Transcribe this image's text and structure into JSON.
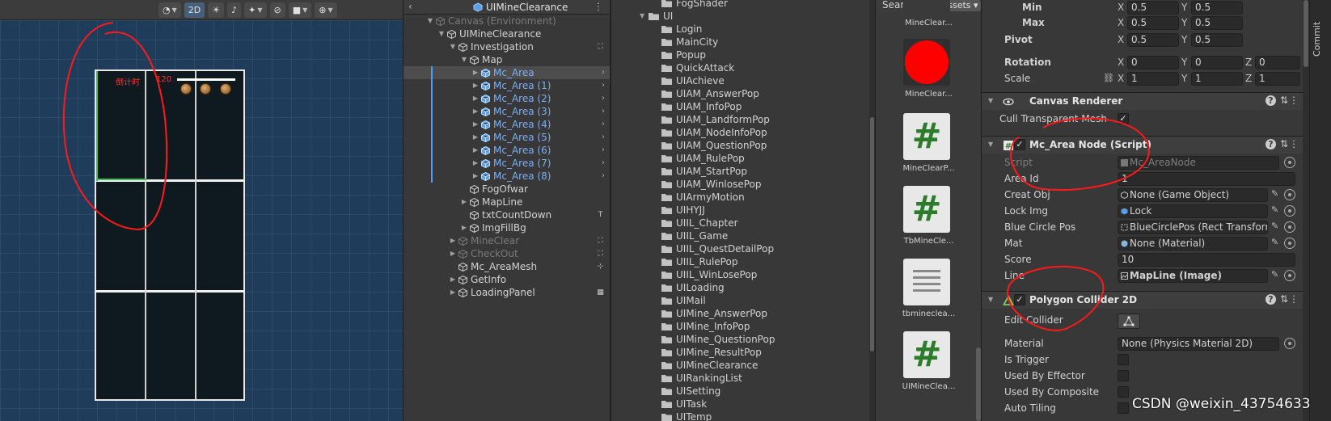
{
  "scene": {
    "toolbar": {
      "shading_icon": "sphere-icon",
      "mode_2d": "2D",
      "light_icon": "light-icon",
      "audio_icon": "audio-icon",
      "effects_icon": "effects-icon",
      "visibility_icon": "visibility-off-icon",
      "camera_icon": "camera-icon",
      "gizmo_icon": "gizmo-icon"
    },
    "canvas": {
      "countdown_label": "倒计时",
      "countdown_value": "120"
    },
    "annotation_color": "#ff1a1a"
  },
  "hierarchy": {
    "title": "UIMineClearance",
    "rows": [
      {
        "label": "Canvas (Environment)",
        "depth": 3,
        "arrow": "▼",
        "dim": true
      },
      {
        "label": "UIMineClearance",
        "depth": 4,
        "arrow": "▼"
      },
      {
        "label": "Investigation",
        "depth": 5,
        "arrow": "▼",
        "right_icon": "⛶"
      },
      {
        "label": "Map",
        "depth": 6,
        "arrow": "▼"
      },
      {
        "label": "Mc_Area",
        "depth": 7,
        "arrow": "▶",
        "blue": true,
        "selected": true,
        "chevron": "›",
        "bar": true
      },
      {
        "label": "Mc_Area (1)",
        "depth": 7,
        "arrow": "▶",
        "blue": true,
        "chevron": "›",
        "bar": true
      },
      {
        "label": "Mc_Area (2)",
        "depth": 7,
        "arrow": "▶",
        "blue": true,
        "chevron": "›",
        "bar": true
      },
      {
        "label": "Mc_Area (3)",
        "depth": 7,
        "arrow": "▶",
        "blue": true,
        "chevron": "›",
        "bar": true
      },
      {
        "label": "Mc_Area (4)",
        "depth": 7,
        "arrow": "▶",
        "blue": true,
        "chevron": "›",
        "bar": true
      },
      {
        "label": "Mc_Area (5)",
        "depth": 7,
        "arrow": "▶",
        "blue": true,
        "chevron": "›",
        "bar": true
      },
      {
        "label": "Mc_Area (6)",
        "depth": 7,
        "arrow": "▶",
        "blue": true,
        "chevron": "›",
        "bar": true
      },
      {
        "label": "Mc_Area (7)",
        "depth": 7,
        "arrow": "▶",
        "blue": true,
        "chevron": "›",
        "bar": true
      },
      {
        "label": "Mc_Area (8)",
        "depth": 7,
        "arrow": "▶",
        "blue": true,
        "chevron": "›",
        "bar": true
      },
      {
        "label": "FogOfwar",
        "depth": 6,
        "arrow": ""
      },
      {
        "label": "MapLine",
        "depth": 6,
        "arrow": "▶"
      },
      {
        "label": "txtCountDown",
        "depth": 6,
        "arrow": "",
        "right_icon": "T"
      },
      {
        "label": "ImgFillBg",
        "depth": 6,
        "arrow": "▶"
      },
      {
        "label": "MineClear",
        "depth": 5,
        "arrow": "▶",
        "dim": true,
        "right_icon": "⛶"
      },
      {
        "label": "CheckOut",
        "depth": 5,
        "arrow": "▶",
        "dim": true,
        "right_icon": "⛶"
      },
      {
        "label": "Mc_AreaMesh",
        "depth": 5,
        "arrow": "",
        "right_icon": "⊹"
      },
      {
        "label": "GetInfo",
        "depth": 5,
        "arrow": "▶"
      },
      {
        "label": "LoadingPanel",
        "depth": 5,
        "arrow": "▶",
        "right_icon": "▦"
      }
    ]
  },
  "project": {
    "rows": [
      {
        "label": "FogShader",
        "indent": 2
      },
      {
        "label": "UI",
        "indent": 1,
        "arrow": "▼"
      },
      {
        "label": "Login",
        "indent": 2
      },
      {
        "label": "MainCity",
        "indent": 2
      },
      {
        "label": "Popup",
        "indent": 2
      },
      {
        "label": "QuickAttack",
        "indent": 2
      },
      {
        "label": "UIAchieve",
        "indent": 2
      },
      {
        "label": "UIAM_AnswerPop",
        "indent": 2
      },
      {
        "label": "UIAM_InfoPop",
        "indent": 2
      },
      {
        "label": "UIAM_LandformPop",
        "indent": 2
      },
      {
        "label": "UIAM_NodeInfoPop",
        "indent": 2
      },
      {
        "label": "UIAM_QuestionPop",
        "indent": 2
      },
      {
        "label": "UIAM_RulePop",
        "indent": 2
      },
      {
        "label": "UIAM_StartPop",
        "indent": 2
      },
      {
        "label": "UIAM_WinlosePop",
        "indent": 2
      },
      {
        "label": "UIArmyMotion",
        "indent": 2
      },
      {
        "label": "UIHYJJ",
        "indent": 2
      },
      {
        "label": "UIIL_Chapter",
        "indent": 2
      },
      {
        "label": "UIIL_Game",
        "indent": 2
      },
      {
        "label": "UIIL_QuestDetailPop",
        "indent": 2
      },
      {
        "label": "UIIL_RulePop",
        "indent": 2
      },
      {
        "label": "UIIL_WinLosePop",
        "indent": 2
      },
      {
        "label": "UILoading",
        "indent": 2
      },
      {
        "label": "UIMail",
        "indent": 2
      },
      {
        "label": "UIMine_AnswerPop",
        "indent": 2
      },
      {
        "label": "UIMine_InfoPop",
        "indent": 2
      },
      {
        "label": "UIMine_QuestionPop",
        "indent": 2
      },
      {
        "label": "UIMine_ResultPop",
        "indent": 2
      },
      {
        "label": "UIMineClearance",
        "indent": 2
      },
      {
        "label": "UIRankingList",
        "indent": 2
      },
      {
        "label": "UISetting",
        "indent": 2
      },
      {
        "label": "UITask",
        "indent": 2
      },
      {
        "label": "UITemp",
        "indent": 2
      }
    ]
  },
  "assets": {
    "search_label": "Search:",
    "search_scope": "In Assets",
    "items": [
      {
        "name": "MineClear...",
        "kind": "partial"
      },
      {
        "name": "MineClear...",
        "kind": "red-circle"
      },
      {
        "name": "MineClearP...",
        "kind": "script"
      },
      {
        "name": "TbMineCle...",
        "kind": "script"
      },
      {
        "name": "tbminecleа...",
        "kind": "text"
      },
      {
        "name": "UIMineClea...",
        "kind": "script"
      }
    ]
  },
  "inspector": {
    "min": {
      "label": "Min",
      "x": "0.5",
      "y": "0.5"
    },
    "max": {
      "label": "Max",
      "x": "0.5",
      "y": "0.5"
    },
    "pivot": {
      "label": "Pivot",
      "x": "0.5",
      "y": "0.5"
    },
    "rotation": {
      "label": "Rotation",
      "x": "0",
      "y": "0",
      "z": "0"
    },
    "scale": {
      "label": "Scale",
      "x": "1",
      "y": "1",
      "z": "1"
    },
    "axis": {
      "x": "X",
      "y": "Y",
      "z": "Z"
    },
    "canvas_renderer": {
      "title": "Canvas Renderer",
      "cull_label": "Cull Transparent Mesh",
      "cull_check": "✓"
    },
    "mc_area_node": {
      "title": "Mc_Area Node (Script)",
      "script_label": "Script",
      "script_value": "Mc_AreaNode",
      "area_id_label": "Area Id",
      "area_id_value": "1",
      "creat_obj_label": "Creat Obj",
      "creat_obj_value": "None (Game Object)",
      "lock_img_label": "Lock Img",
      "lock_img_value": "Lock",
      "blue_circle_label": "Blue Circle Pos",
      "blue_circle_value": "BlueCirclePos (Rect Transform)",
      "mat_label": "Mat",
      "mat_value": "None (Material)",
      "score_label": "Score",
      "score_value": "10",
      "line_label": "Line",
      "line_value": "MapLine (Image)"
    },
    "polygon_collider": {
      "title": "Polygon Collider 2D",
      "enabled_check": "✓",
      "edit_collider_label": "Edit Collider",
      "material_label": "Material",
      "material_value": "None (Physics Material 2D)",
      "is_trigger_label": "Is Trigger",
      "used_by_effector_label": "Used By Effector",
      "used_by_composite_label": "Used By Composite",
      "auto_tiling_label": "Auto Tiling"
    },
    "help_glyph": "?",
    "preset_glyph": "⇅",
    "menu_glyph": "⋮"
  },
  "commit_label": "Commit",
  "watermark": "CSDN @weixin_43754633"
}
